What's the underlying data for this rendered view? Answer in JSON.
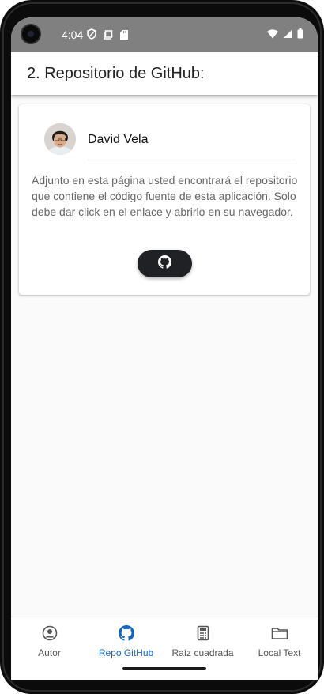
{
  "status_bar": {
    "time": "4:04",
    "icons_left": [
      "shield-icon",
      "screenshot-icon",
      "sd-card-icon"
    ],
    "icons_right": [
      "wifi-icon",
      "signal-icon",
      "battery-icon"
    ]
  },
  "app_bar": {
    "title": "2. Repositorio de GitHub:"
  },
  "card": {
    "author_name": "David Vela",
    "description": "Adjunto en esta página usted encontrará el repositorio que contiene el código fuente de esta aplicación. Solo debe dar click en el enlace y abrirlo en su navegador.",
    "button_icon": "github-icon"
  },
  "bottom_nav": {
    "items": [
      {
        "label": "Autor",
        "icon": "account-circle-icon",
        "active": false
      },
      {
        "label": "Repo GitHub",
        "icon": "github-icon",
        "active": true
      },
      {
        "label": "Raíz cuadrada",
        "icon": "calculator-icon",
        "active": false
      },
      {
        "label": "Local Text",
        "icon": "folder-icon",
        "active": false
      }
    ]
  },
  "colors": {
    "status_bar": "#808080",
    "active_nav": "#1565c0",
    "button": "#202124"
  }
}
